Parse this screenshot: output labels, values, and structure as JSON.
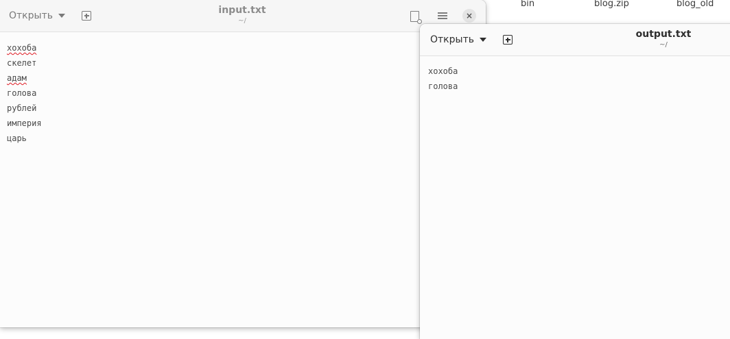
{
  "desktop": {
    "files": [
      "bin",
      "blog.zip",
      "blog_old"
    ]
  },
  "input_window": {
    "open_label": "Открыть",
    "title": "input.txt",
    "subtitle": "~/",
    "close_glyph": "×",
    "lines": [
      {
        "text": "хохоба",
        "misspelled": true
      },
      {
        "text": "скелет",
        "misspelled": false
      },
      {
        "text": "адам",
        "misspelled": true
      },
      {
        "text": "голова",
        "misspelled": false
      },
      {
        "text": "рублей",
        "misspelled": false
      },
      {
        "text": "империя",
        "misspelled": false
      },
      {
        "text": "царь",
        "misspelled": false
      }
    ]
  },
  "output_window": {
    "open_label": "Открыть",
    "title": "output.txt",
    "subtitle": "~/",
    "lines": [
      {
        "text": "хохоба"
      },
      {
        "text": "голова"
      }
    ]
  },
  "colors": {
    "spell_underline": "#e01b24",
    "header_bg": "#f6f6f6",
    "editor_bg": "#fcfcfc"
  }
}
